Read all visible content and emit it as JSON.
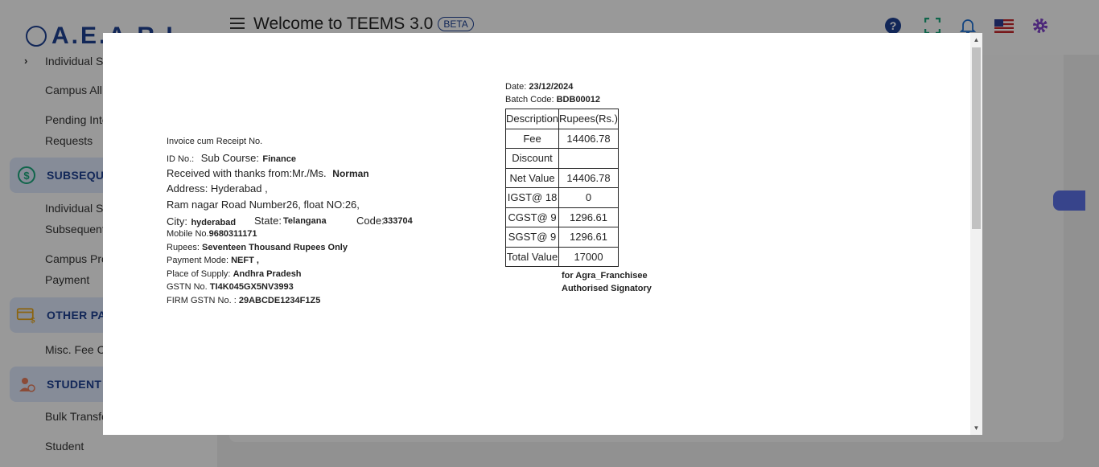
{
  "app": {
    "logo_text": "A.E.A.R.I",
    "title": "Welcome to TEEMS 3.0",
    "beta_badge": "BETA",
    "icons": [
      "help-icon",
      "fullscreen-icon",
      "notification-bell-icon",
      "us-flag-icon",
      "settings-gear-icon"
    ],
    "accent_color": "#1d3f8f"
  },
  "sidebar": {
    "items": [
      {
        "label": "Individual S"
      },
      {
        "label": "Campus All"
      },
      {
        "label": "Pending Inte"
      },
      {
        "label": "Requests"
      },
      {
        "label": "Individual S"
      },
      {
        "label": "Subsequent"
      },
      {
        "label": "Campus Pro"
      },
      {
        "label": "Payment"
      },
      {
        "label": "Misc. Fee C"
      },
      {
        "label": "Bulk Transfe"
      },
      {
        "label": "Student"
      }
    ],
    "sections": [
      {
        "label": "SUBSEQUE",
        "icon": "dollar-circle-icon"
      },
      {
        "label": "OTHER PA",
        "icon": "card-dollar-icon"
      },
      {
        "label": "STUDENT M",
        "icon": "student-icon"
      }
    ]
  },
  "receipt": {
    "invoice_label": "Invoice cum Receipt No.",
    "id_label": "ID No.:",
    "sub_course_label": "Sub Course:",
    "sub_course_value": "Finance",
    "received_label": "Received with thanks from:Mr./Ms.",
    "received_value": "Norman",
    "address_line1": "Address: Hyderabad ,",
    "address_line2": "Ram nagar Road Number26, float NO:26,",
    "city_label": "City:",
    "city_value": "hyderabad",
    "state_label": "State:",
    "state_value": "Telangana",
    "code_label": "Code:",
    "code_value": "333704",
    "mobile_label": "Mobile No.",
    "mobile_value": "9680311171",
    "rupees_label": "Rupees:",
    "rupees_value": "Seventeen Thousand Rupees Only",
    "payment_mode_label": "Payment Mode:",
    "payment_mode_value": "NEFT ,",
    "place_label": "Place of Supply:",
    "place_value": "Andhra Pradesh",
    "gstn_label": "GSTN No.",
    "gstn_value": "TI4K045GX5NV3993",
    "firm_gstn_label": "FIRM GSTN No. :",
    "firm_gstn_value": "29ABCDE1234F1Z5",
    "date_label": "Date:",
    "date_value": "23/12/2024",
    "batch_label": "Batch Code:",
    "batch_value": "BDB00012",
    "table": {
      "headers": [
        "Description",
        "Rupees(Rs.)"
      ],
      "rows": [
        [
          "Fee",
          "14406.78"
        ],
        [
          "Discount",
          ""
        ],
        [
          "Net Value",
          "14406.78"
        ],
        [
          "IGST@ 18",
          "0"
        ],
        [
          "CGST@ 9",
          "1296.61"
        ],
        [
          "SGST@ 9",
          "1296.61"
        ],
        [
          "Total Value",
          "17000"
        ]
      ]
    },
    "signatory_for": "for Agra_Franchisee",
    "signatory_title": "Authorised Signatory"
  }
}
